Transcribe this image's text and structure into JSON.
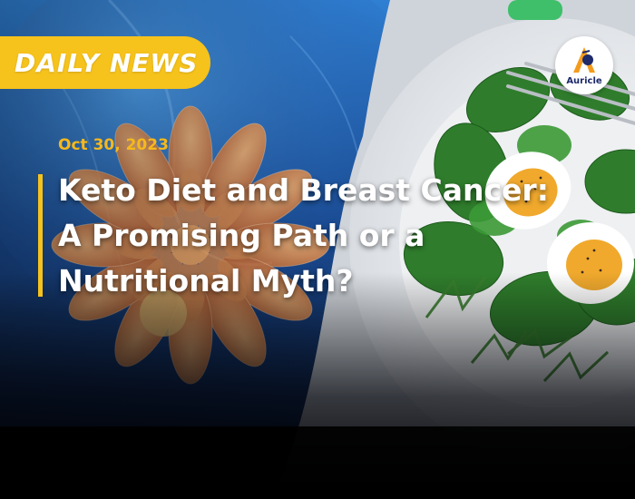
{
  "badge": {
    "label": "DAILY NEWS"
  },
  "article": {
    "date": "Oct 30, 2023",
    "headline_lines": [
      "Keto Diet and Breast Cancer:",
      "A Promising Path or a",
      "Nutritional Myth?"
    ]
  },
  "logo": {
    "text": "Auricle"
  },
  "colors": {
    "accent": "#f6c21c",
    "date": "#f6b81c",
    "headline": "#ffffff"
  }
}
